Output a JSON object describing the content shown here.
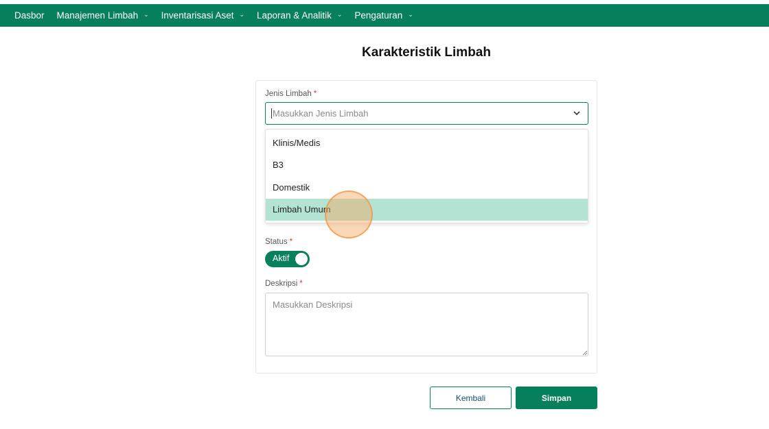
{
  "nav": {
    "items": [
      {
        "label": "Dasbor",
        "has_dropdown": false
      },
      {
        "label": "Manajemen Limbah",
        "has_dropdown": true
      },
      {
        "label": "Inventarisasi Aset",
        "has_dropdown": true
      },
      {
        "label": "Laporan & Analitik",
        "has_dropdown": true
      },
      {
        "label": "Pengaturan",
        "has_dropdown": true
      }
    ],
    "color": "#067f5b"
  },
  "page": {
    "title": "Karakteristik Limbah"
  },
  "form": {
    "jenis_limbah": {
      "label": "Jenis Limbah",
      "required_mark": "*",
      "placeholder": "Masukkan Jenis Limbah",
      "value": "",
      "options": [
        "Klinis/Medis",
        "B3",
        "Domestik",
        "Limbah Umum"
      ],
      "highlighted_option": "Limbah Umum"
    },
    "status": {
      "label": "Status",
      "required_mark": "*",
      "toggle_label": "Aktif",
      "on": true
    },
    "deskripsi": {
      "label": "Deskripsi",
      "required_mark": "*",
      "placeholder": "Masukkan Deskripsi",
      "value": ""
    }
  },
  "buttons": {
    "back_label": "Kembali",
    "save_label": "Simpan"
  },
  "icons": {
    "dropdown_arrow": "chevron-down-icon",
    "nav_chevron": "chevron-down-icon"
  },
  "colors": {
    "primary": "#067f5b",
    "highlight": "#b3e3d3",
    "required": "#e53935"
  }
}
